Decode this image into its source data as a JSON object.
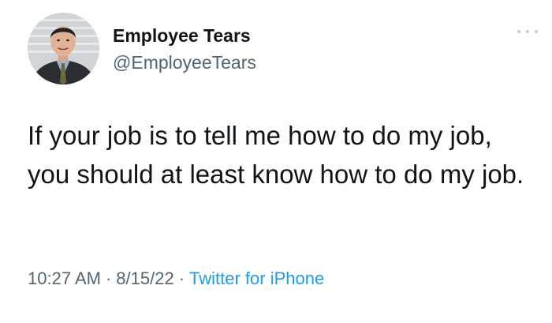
{
  "author": {
    "display_name": "Employee Tears",
    "handle": "@EmployeeTears",
    "avatar_icon": "profile-photo"
  },
  "tweet": {
    "text": "If your job is to tell me how to do my job, you should at least know how to do my job."
  },
  "meta": {
    "time": "10:27 AM",
    "separator": "·",
    "date": "8/15/22",
    "source": "Twitter for iPhone"
  },
  "colors": {
    "text": "#0f1419",
    "secondary": "#536471",
    "link": "#1d9bf0",
    "more_dots": "#c4cfd6"
  },
  "more_menu_icon": "more-horizontal-icon"
}
